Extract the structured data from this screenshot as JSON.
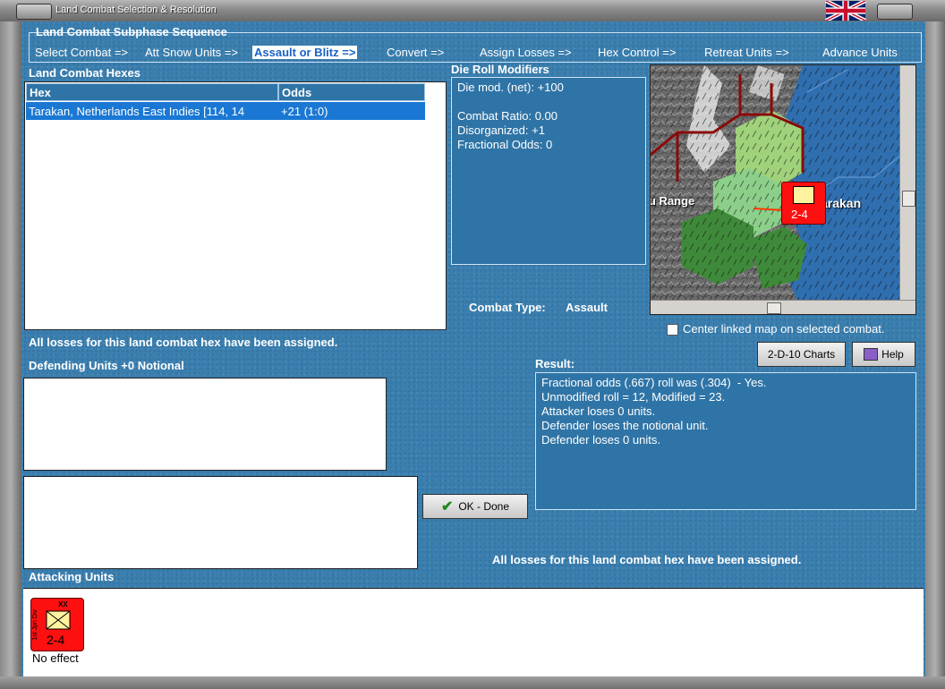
{
  "window": {
    "title": "Land Combat Selection & Resolution"
  },
  "subphase": {
    "heading": "Land Combat Subphase Sequence",
    "steps": [
      "Select Combat =>",
      "Att Snow Units =>",
      "Assault or Blitz =>",
      "Convert =>",
      "Assign Losses =>",
      "Hex Control =>",
      "Retreat Units =>",
      "Advance Units"
    ],
    "active_index": 2
  },
  "hexes": {
    "heading": "Land Combat Hexes",
    "columns": [
      "Hex",
      "Odds"
    ],
    "rows": [
      {
        "hex": "Tarakan, Netherlands East Indies [114, 14",
        "odds": "+21 (1:0)"
      }
    ],
    "status": "All losses for this land combat hex have been assigned."
  },
  "modifiers": {
    "heading": "Die Roll Modifiers",
    "lines": [
      "Die mod. (net): +100",
      "",
      "Combat Ratio: 0.00",
      "Disorganized: +1",
      "Fractional Odds: 0"
    ]
  },
  "map": {
    "labels": [
      "u Range",
      "arakan"
    ],
    "unit_value": "2-4",
    "center_checkbox_label": "Center linked map on selected combat.",
    "center_checked": false
  },
  "combat_type": {
    "label": "Combat Type:",
    "value": "Assault"
  },
  "defending": {
    "heading": "Defending Units +0 Notional"
  },
  "buttons": {
    "charts": "2-D-10 Charts",
    "help": "Help",
    "ok": "OK - Done"
  },
  "result": {
    "heading": "Result:",
    "lines": [
      "Fractional odds (.667) roll was (.304)  - Yes.",
      "Unmodified roll = 12, Modified = 23.",
      "Attacker loses 0 units.",
      "Defender loses the notional unit.",
      "Defender loses 0 units."
    ],
    "status": "All losses for this land combat hex have been assigned."
  },
  "attacking": {
    "heading": "Attacking Units",
    "units": [
      {
        "value": "2-4",
        "size": "XX",
        "side_label": "1st Jpn Div",
        "effect": "No effect"
      }
    ]
  },
  "colors": {
    "panel": "#3a7fb0",
    "selection": "#1a78d4",
    "unit_red": "#ff1010"
  }
}
